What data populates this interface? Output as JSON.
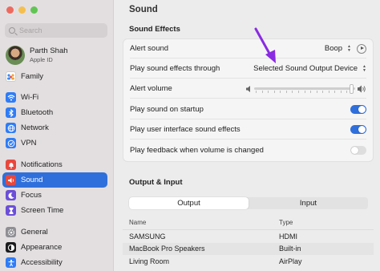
{
  "sidebar": {
    "search_placeholder": "Search",
    "user": {
      "name": "Parth Shah",
      "subtitle": "Apple ID"
    },
    "items": [
      {
        "label": "Family",
        "icon": "family-icon",
        "color": "#ffffff"
      },
      {
        "label": "Wi-Fi",
        "icon": "wifi-icon",
        "color": "#2f7cf6"
      },
      {
        "label": "Bluetooth",
        "icon": "bluetooth-icon",
        "color": "#2f7cf6"
      },
      {
        "label": "Network",
        "icon": "network-icon",
        "color": "#2f7cf6"
      },
      {
        "label": "VPN",
        "icon": "vpn-icon",
        "color": "#2f7cf6"
      },
      {
        "label": "Notifications",
        "icon": "notifications-icon",
        "color": "#e9473c"
      },
      {
        "label": "Sound",
        "icon": "sound-icon",
        "color": "#e9473c"
      },
      {
        "label": "Focus",
        "icon": "focus-icon",
        "color": "#6b4fd8"
      },
      {
        "label": "Screen Time",
        "icon": "screen-time-icon",
        "color": "#6b4fd8"
      },
      {
        "label": "General",
        "icon": "general-icon",
        "color": "#8e8e93"
      },
      {
        "label": "Appearance",
        "icon": "appearance-icon",
        "color": "#1c1c1e"
      },
      {
        "label": "Accessibility",
        "icon": "accessibility-icon",
        "color": "#2f7cf6"
      }
    ],
    "selected": "Sound"
  },
  "main": {
    "title": "Sound",
    "sound_effects": {
      "heading": "Sound Effects",
      "alert_sound": {
        "label": "Alert sound",
        "value": "Boop"
      },
      "play_through": {
        "label": "Play sound effects through",
        "value": "Selected Sound Output Device"
      },
      "alert_volume": {
        "label": "Alert volume",
        "level": 0.98
      },
      "startup": {
        "label": "Play sound on startup",
        "on": true
      },
      "ui_sounds": {
        "label": "Play user interface sound effects",
        "on": true
      },
      "feedback": {
        "label": "Play feedback when volume is changed",
        "on": false
      }
    },
    "output_input": {
      "heading": "Output & Input",
      "tabs": [
        "Output",
        "Input"
      ],
      "selected_tab": "Output",
      "columns": [
        "Name",
        "Type"
      ],
      "devices": [
        {
          "name": "SAMSUNG",
          "type": "HDMI"
        },
        {
          "name": "MacBook Pro Speakers",
          "type": "Built-in"
        },
        {
          "name": "Living Room",
          "type": "AirPlay"
        }
      ]
    }
  },
  "colors": {
    "accent": "#2f6fdb",
    "annotation_arrow": "#8a2be2"
  }
}
